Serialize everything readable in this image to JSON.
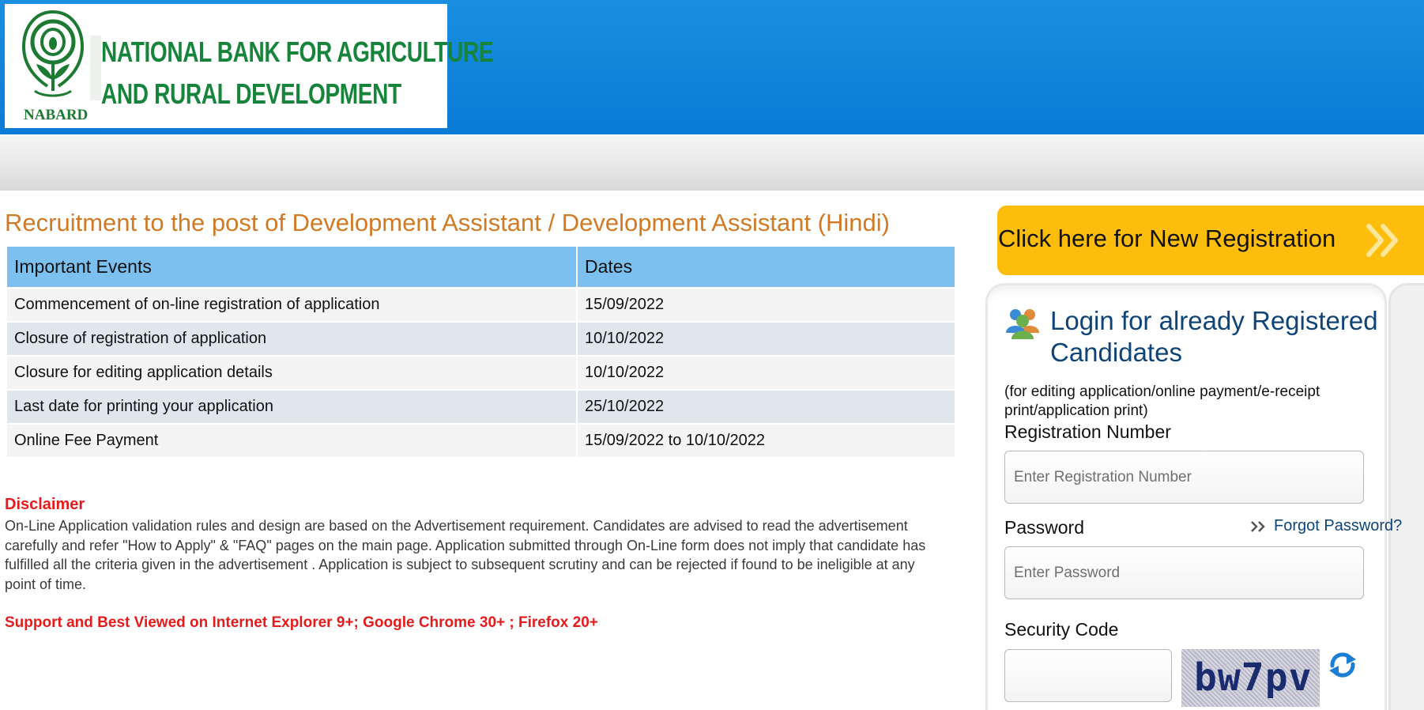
{
  "header": {
    "logo_line1": "NATIONAL BANK FOR AGRICULTURE",
    "logo_line2": "AND RURAL DEVELOPMENT",
    "logo_abbr": "NABARD"
  },
  "page_title": "Recruitment to the post of Development Assistant / Development Assistant (Hindi)",
  "events_table": {
    "headers": [
      "Important Events",
      "Dates"
    ],
    "rows": [
      [
        "Commencement of on-line registration of application",
        "15/09/2022"
      ],
      [
        "Closure of registration of application",
        "10/10/2022"
      ],
      [
        "Closure for editing application details",
        "10/10/2022"
      ],
      [
        "Last date for printing your application",
        "25/10/2022"
      ],
      [
        "Online Fee Payment",
        "15/09/2022 to 10/10/2022"
      ]
    ]
  },
  "disclaimer": {
    "title": "Disclaimer",
    "text": "On-Line Application validation rules and design are based on the Advertisement requirement. Candidates are advised to read the advertisement carefully and refer \"How to Apply\" & \"FAQ\" pages on the main page. Application submitted through On-Line form does not imply that candidate has fulfilled all the criteria given in the advertisement . Application is subject to subsequent scrutiny and can be rejected if found to be ineligible at any point of time."
  },
  "support_note": "Support and Best Viewed on Internet Explorer 9+; Google Chrome 30+ ; Firefox 20+",
  "registration_button": {
    "label": "Click here for New Registration",
    "icon": "double-chevron-right-icon"
  },
  "login": {
    "title": "Login for already Registered Candidates",
    "subtitle": "(for editing application/online payment/e-receipt print/application print)",
    "reg_number_label": "Registration Number",
    "reg_number_placeholder": "Enter Registration Number",
    "password_label": "Password",
    "password_placeholder": "Enter Password",
    "forgot_password": "Forgot Password?",
    "security_code_label": "Security Code",
    "captcha_text": "bw7pv"
  },
  "colors": {
    "header_blue": "#0a7bd6",
    "title_orange": "#d07a25",
    "table_header": "#7cc0ef",
    "disclaimer_red": "#e51b1b",
    "button_yellow": "#fdbd0c",
    "login_title_blue": "#0e4478",
    "logo_green": "#16843a"
  }
}
